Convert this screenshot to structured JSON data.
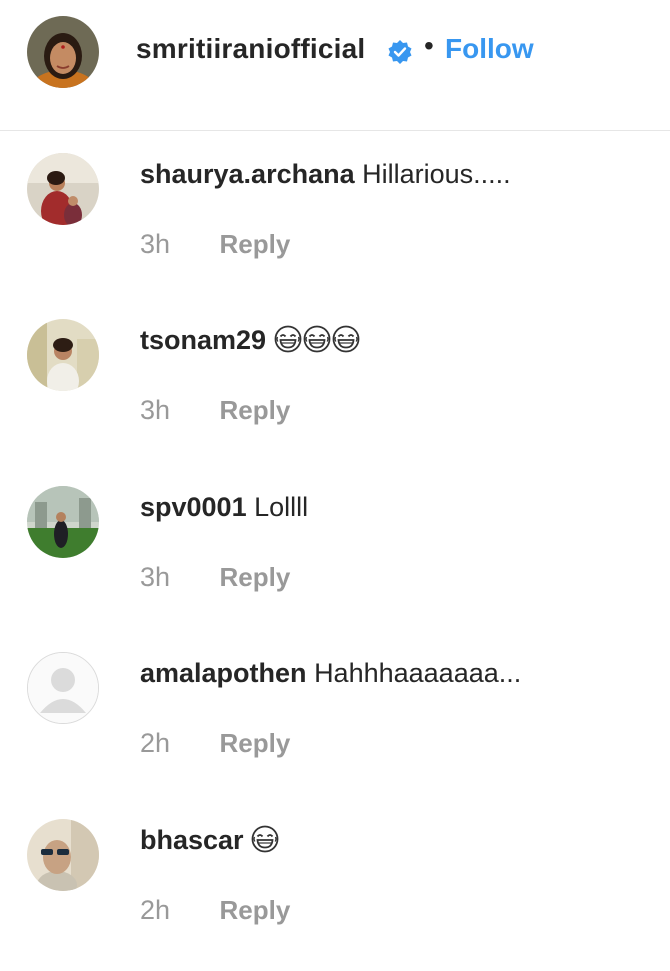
{
  "header": {
    "username": "smritiiraniofficial",
    "separator": "•",
    "follow_label": "Follow",
    "verified_icon": "verified-badge-icon",
    "accent_color": "#3897f0"
  },
  "comments": [
    {
      "username": "shaurya.archana",
      "text": "Hillarious.....",
      "time": "3h",
      "reply_label": "Reply"
    },
    {
      "username": "tsonam29",
      "text": "",
      "emoji_icon": "laughing-emoji-icon",
      "emoji_count": 3,
      "time": "3h",
      "reply_label": "Reply"
    },
    {
      "username": "spv0001",
      "text": "Lollll",
      "time": "3h",
      "reply_label": "Reply"
    },
    {
      "username": "amalapothen",
      "text": "Hahhhaaaaaaa...",
      "time": "2h",
      "reply_label": "Reply"
    },
    {
      "username": "bhascar",
      "text": "",
      "emoji_icon": "laughing-emoji-icon",
      "emoji_count": 1,
      "time": "2h",
      "reply_label": "Reply"
    }
  ]
}
